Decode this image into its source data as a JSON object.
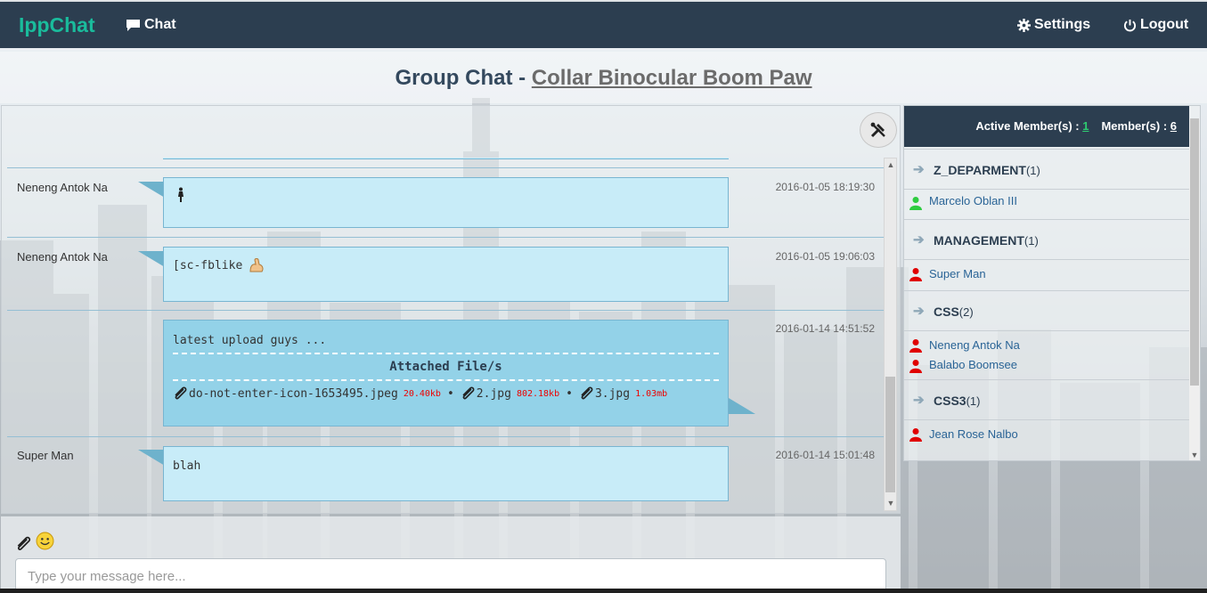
{
  "nav": {
    "brand": "IppChat",
    "chat": "Chat",
    "settings": "Settings",
    "logout": "Logout"
  },
  "title": {
    "prefix": "Group Chat - ",
    "group_name": "Collar Binocular Boom Paw"
  },
  "messages": [
    {
      "sender": "Neneng Antok Na",
      "time": "2016-01-05 18:19:30",
      "text": ""
    },
    {
      "sender": "Neneng Antok Na",
      "time": "2016-01-05 19:06:03",
      "text": "[sc-fblike"
    },
    {
      "sender": "",
      "time": "2016-01-14 14:51:52",
      "text": "latest upload guys ...",
      "attachments_title": "Attached File/s",
      "files": [
        {
          "name": "do-not-enter-icon-1653495.jpeg",
          "size": "20.40kb"
        },
        {
          "name": "2.jpg",
          "size": "802.18kb"
        },
        {
          "name": "3.jpg",
          "size": "1.03mb"
        }
      ]
    },
    {
      "sender": "Super Man",
      "time": "2016-01-14 15:01:48",
      "text": "blah"
    }
  ],
  "input": {
    "placeholder": "Type your message here..."
  },
  "members": {
    "active_label": "Active Member(s) : ",
    "active_count": "1",
    "member_label": "Member(s) : ",
    "member_count": "6",
    "departments": [
      {
        "name": "Z_DEPARMENT",
        "count": "(1)",
        "members": [
          {
            "name": "Marcelo Oblan III",
            "status": "online"
          }
        ]
      },
      {
        "name": "MANAGEMENT",
        "count": "(1)",
        "members": [
          {
            "name": "Super Man",
            "status": "offline"
          }
        ]
      },
      {
        "name": "CSS",
        "count": "(2)",
        "members": [
          {
            "name": "Neneng Antok Na",
            "status": "offline"
          },
          {
            "name": "Balabo Boomsee",
            "status": "offline"
          }
        ]
      },
      {
        "name": "CSS3",
        "count": "(1)",
        "members": [
          {
            "name": "Jean Rose Nalbo",
            "status": "offline"
          }
        ]
      }
    ]
  },
  "colors": {
    "navbar": "#2c3e50",
    "brand": "#1abc9c",
    "bubble": "#c8ecf8",
    "online": "#2ecc40",
    "offline": "#e00000",
    "file_size": "#ee0000"
  }
}
